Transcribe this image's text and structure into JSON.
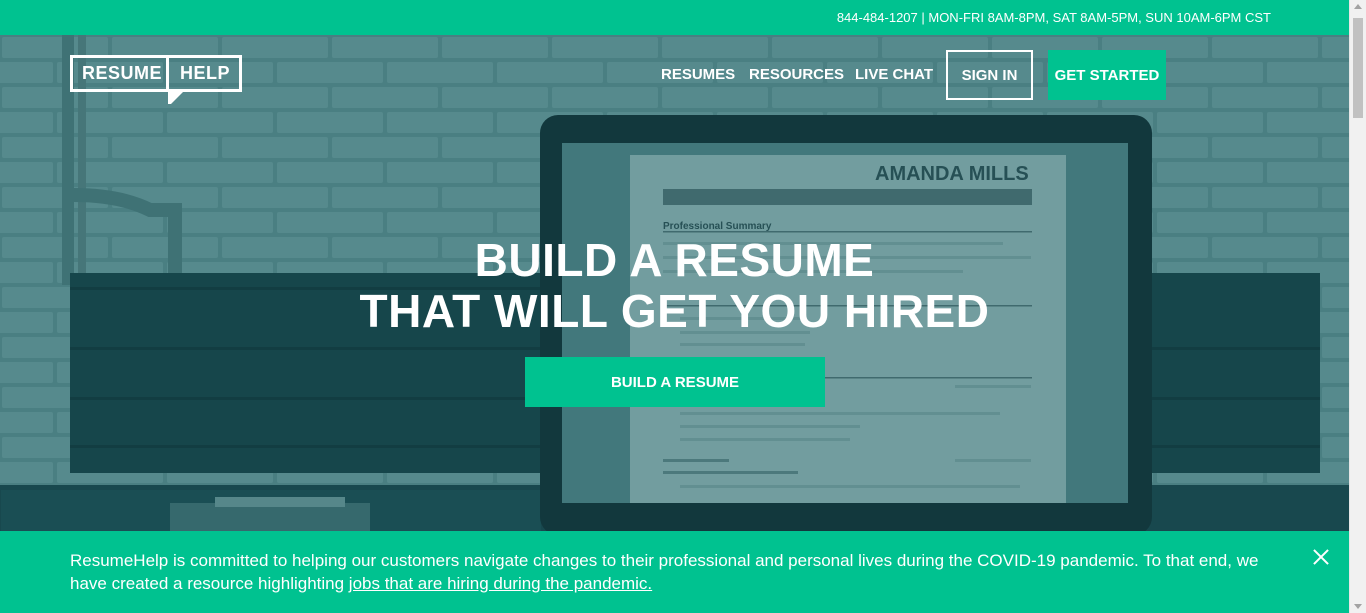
{
  "topbar": {
    "contact": "844-484-1207 | MON-FRI 8AM-8PM, SAT 8AM-5PM, SUN 10AM-6PM CST"
  },
  "logo": {
    "word1": "RESUME",
    "word2": "HELP"
  },
  "nav": {
    "resumes": "RESUMES",
    "resources": "RESOURCES",
    "live_chat": "LIVE CHAT",
    "sign_in": "SIGN IN",
    "get_started": "GET STARTED"
  },
  "hero": {
    "line1": "BUILD A RESUME",
    "line2": "THAT WILL GET YOU HIRED",
    "cta": "BUILD A RESUME"
  },
  "banner": {
    "text": "ResumeHelp is committed to helping our customers navigate changes to their professional and personal lives during the COVID-19 pandemic. To that end, we have created a resource highlighting ",
    "link": "jobs that are hiring during the pandemic."
  },
  "colors": {
    "accent": "#00c290",
    "hero_overlay": "#3d7276"
  }
}
